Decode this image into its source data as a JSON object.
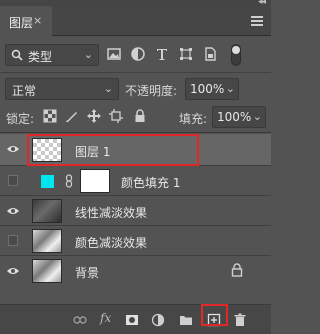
{
  "panel": {
    "tab_label": "图层",
    "tab_close": "×",
    "collapse_glyph": "◂◂"
  },
  "filter": {
    "kind_label": "类型",
    "chevron": "⌄",
    "icons": [
      "image-filter-icon",
      "adjustment-filter-icon",
      "type-filter-icon",
      "shape-filter-icon",
      "smart-object-filter-icon"
    ]
  },
  "blend": {
    "mode": "正常",
    "opacity_label": "不透明度:",
    "opacity_value": "100%"
  },
  "lock": {
    "label": "锁定:",
    "fill_label": "填充:",
    "fill_value": "100%"
  },
  "layers": [
    {
      "name": "图层 1",
      "visible": true,
      "selected": true,
      "thumb": "transparent"
    },
    {
      "name": "颜色填充 1",
      "visible": false,
      "selected": false,
      "thumb": "fill",
      "fill_color": "#00e5f0"
    },
    {
      "name": "线性减淡效果",
      "visible": true,
      "selected": false,
      "thumb": "photo-dark"
    },
    {
      "name": "颜色减淡效果",
      "visible": false,
      "selected": false,
      "thumb": "photo-light"
    },
    {
      "name": "背景",
      "visible": true,
      "selected": false,
      "thumb": "photo-light",
      "locked": true
    }
  ],
  "colors": {
    "highlight": "#e02828",
    "fill_layer": "#00e5f0"
  },
  "bottom": {
    "fx_label": "fx"
  }
}
